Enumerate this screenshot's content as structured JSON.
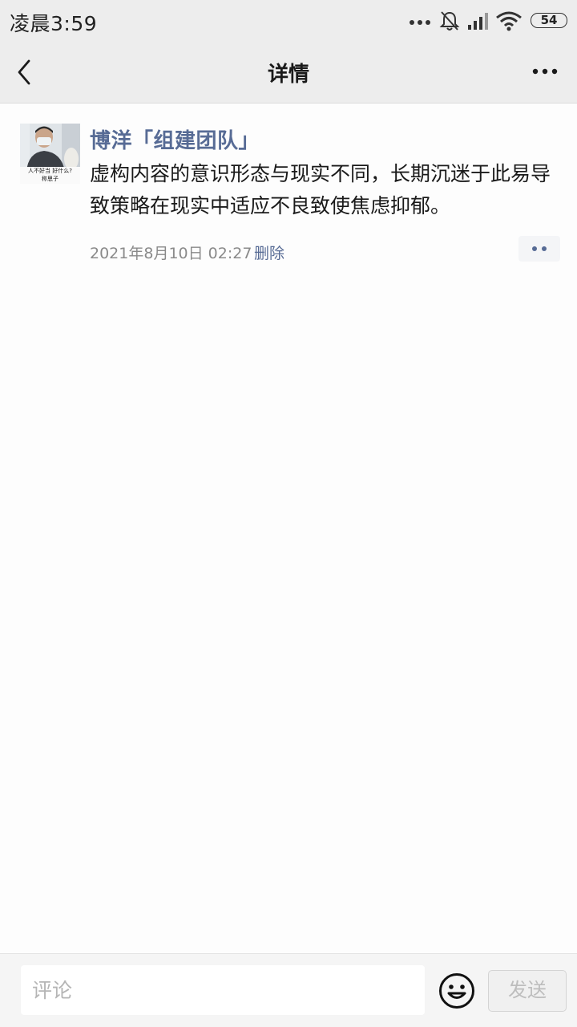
{
  "status_bar": {
    "time": "凌晨3:59",
    "battery": "54",
    "icons": [
      "more-dots-icon",
      "bell-muted-icon",
      "signal-icon",
      "wifi-icon",
      "battery-icon"
    ]
  },
  "nav": {
    "title": "详情",
    "back_icon": "chevron-left-icon",
    "more_icon": "more-dots-icon"
  },
  "post": {
    "author": "博洋「组建团队」",
    "avatar_caption_line1": "人不好当 好什么?",
    "avatar_caption_line2": "称思子",
    "content": "虚构内容的意识形态与现实不同，长期沉迷于此易导致策略在现实中适应不良致使焦虑抑郁。",
    "timestamp": "2021年8月10日 02:27",
    "delete_label": "删除",
    "action_icon": "comment-dots-icon"
  },
  "comment_bar": {
    "placeholder": "评论",
    "value": "",
    "emoji_icon": "smile-emoji-icon",
    "send_label": "发送"
  },
  "colors": {
    "link": "#576b95",
    "bar_background": "#ededed",
    "page_background": "#fdfdfd"
  }
}
